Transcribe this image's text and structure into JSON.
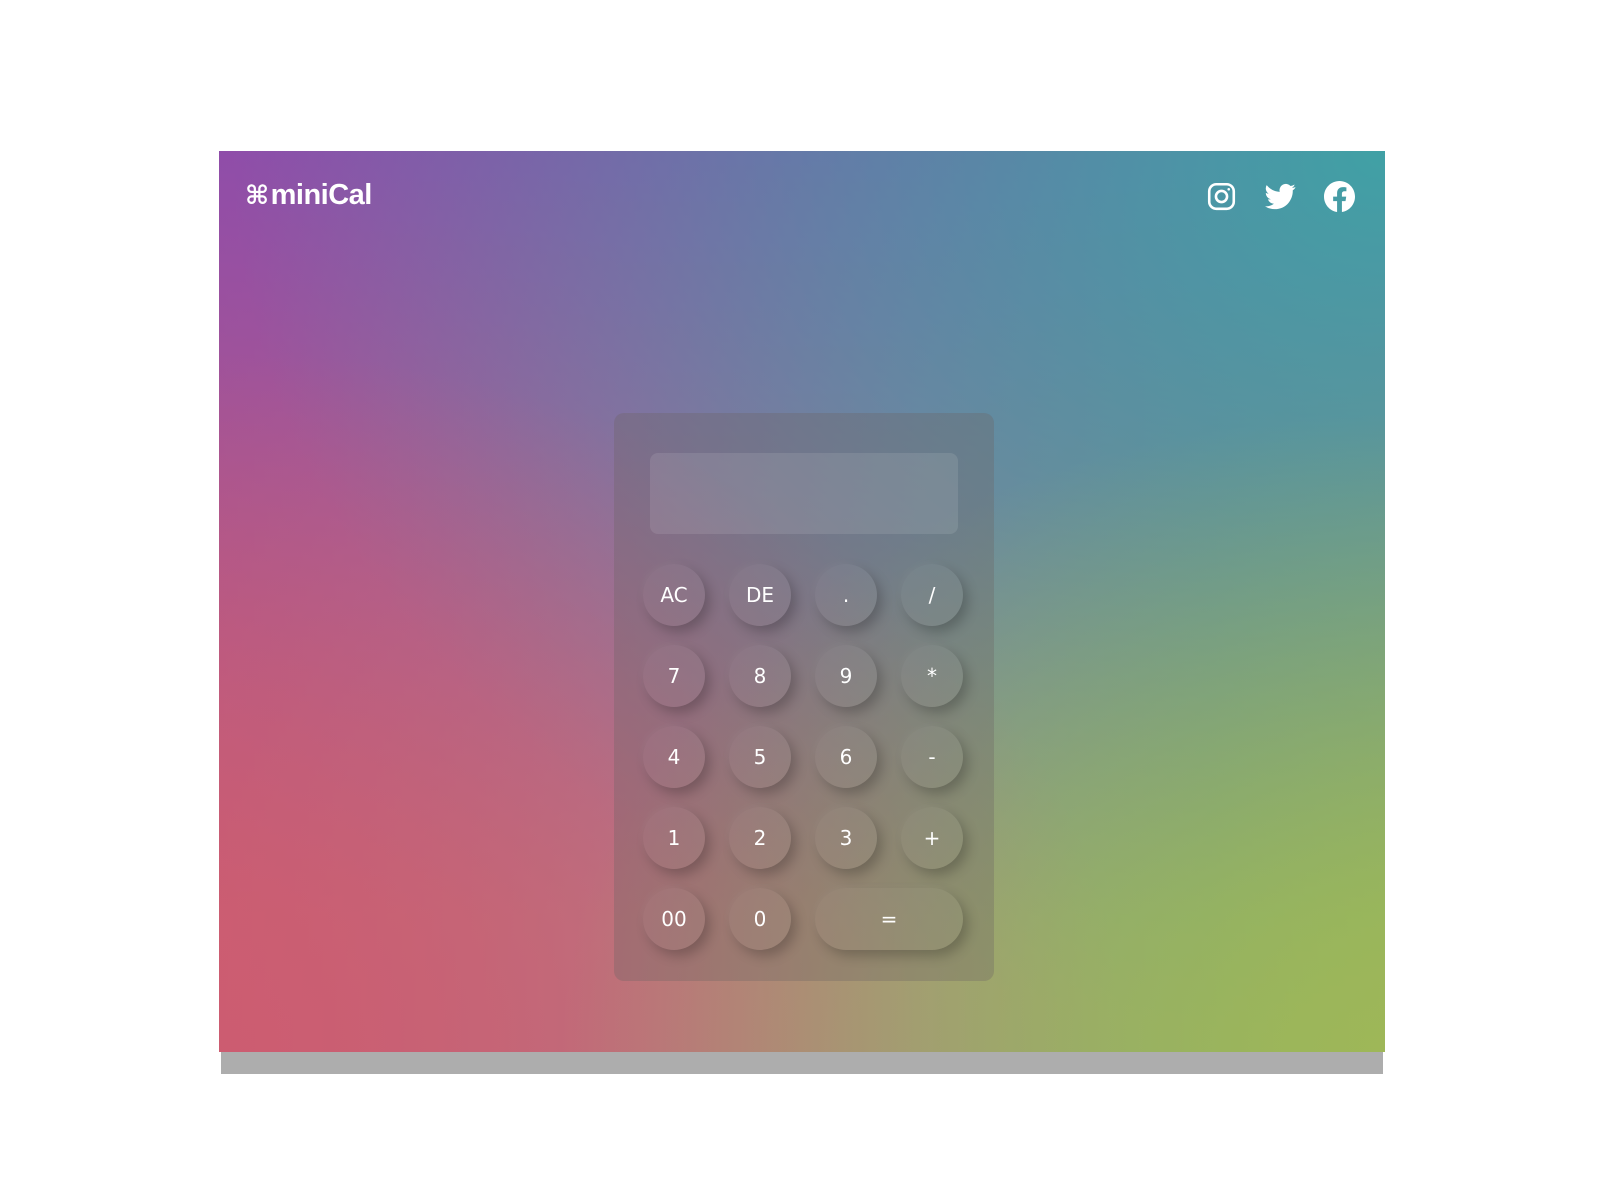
{
  "app": {
    "logo_mark": "⌘",
    "logo_text": "miniCal"
  },
  "social": [
    {
      "name": "instagram-icon"
    },
    {
      "name": "twitter-icon"
    },
    {
      "name": "facebook-icon"
    }
  ],
  "calculator": {
    "display_value": "",
    "keys": {
      "ac": "AC",
      "de": "DE",
      "dot": ".",
      "divide": "/",
      "seven": "7",
      "eight": "8",
      "nine": "9",
      "multiply": "*",
      "four": "4",
      "five": "5",
      "six": "6",
      "minus": "-",
      "one": "1",
      "two": "2",
      "three": "3",
      "plus": "+",
      "double_zero": "00",
      "zero": "0",
      "equals": "="
    }
  },
  "colors": {
    "gradient_top_left": "#8c4cac",
    "gradient_top_right": "#3ca5a5",
    "gradient_bottom_left": "#cd5c70",
    "gradient_bottom_right": "#9eb758",
    "text": "#ffffff"
  }
}
